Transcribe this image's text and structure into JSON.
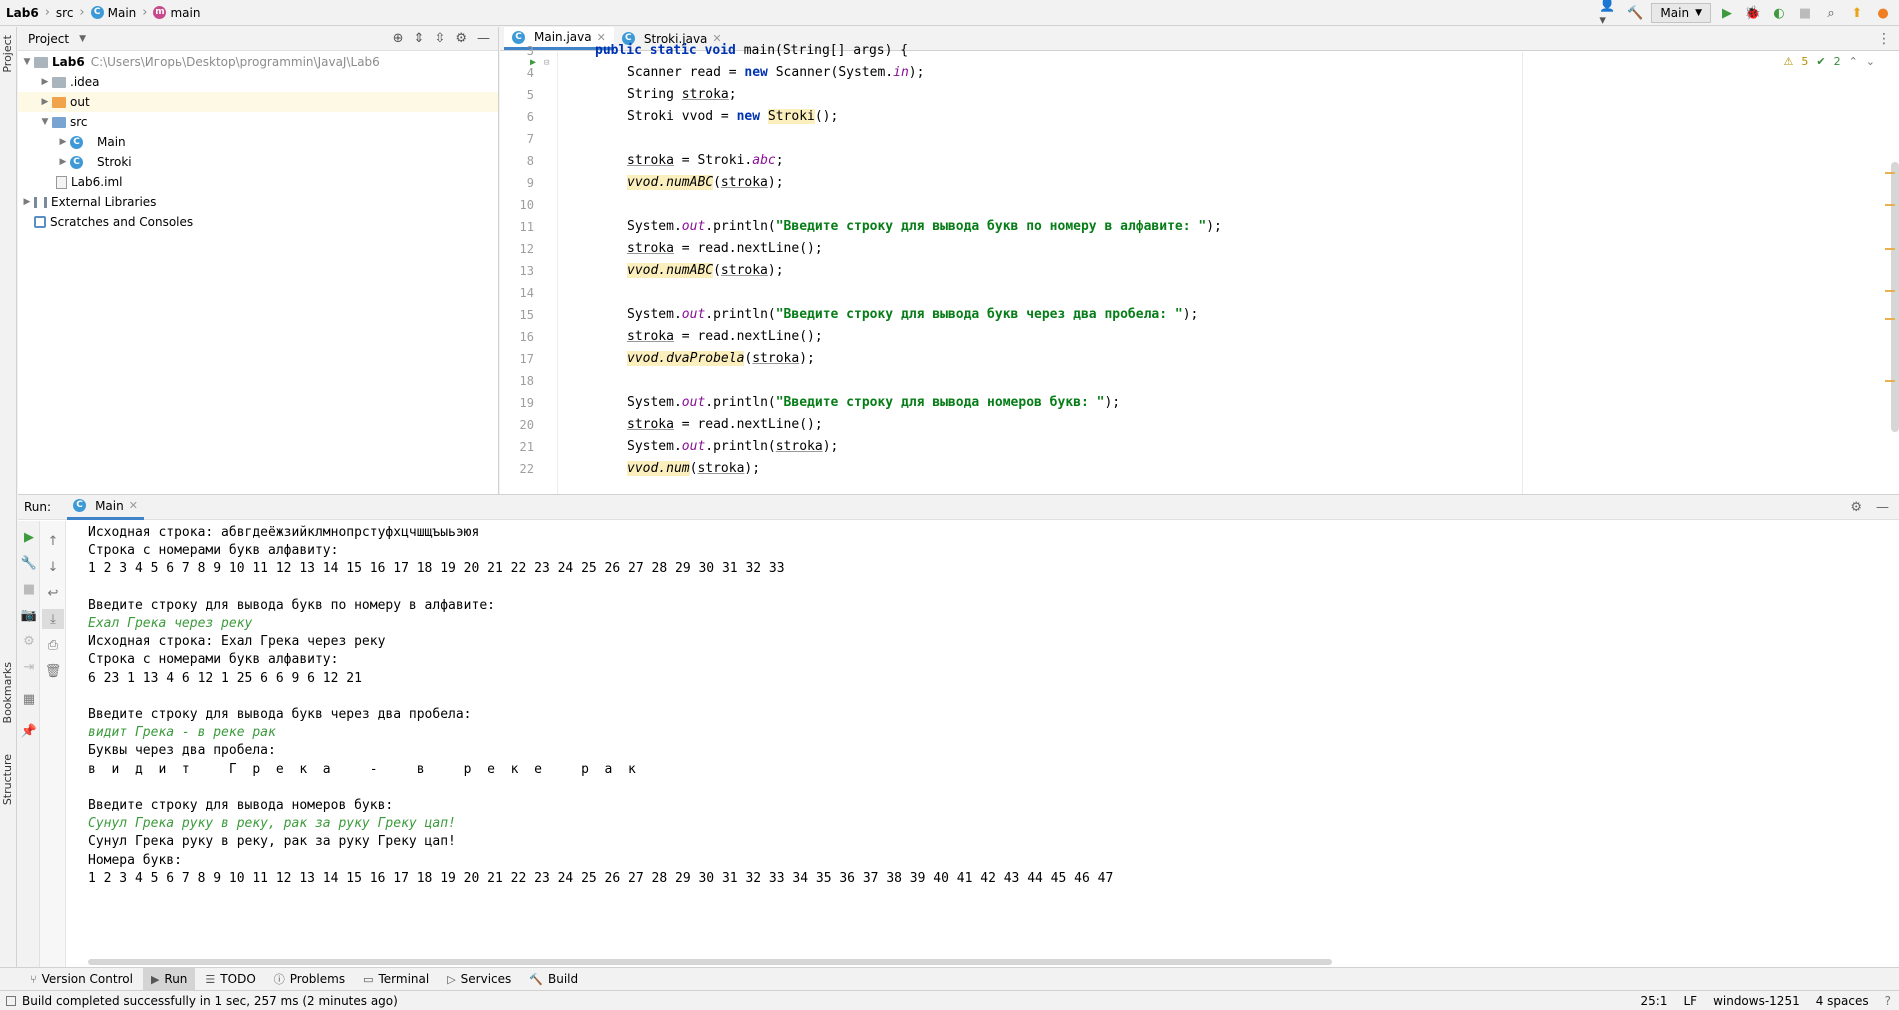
{
  "breadcrumb": {
    "project": "Lab6",
    "folder": "src",
    "class_name": "Main",
    "method": "main"
  },
  "toolbar_top": {
    "run_config": "Main"
  },
  "side_tabs": {
    "project": "Project",
    "bookmarks": "Bookmarks",
    "structure": "Structure"
  },
  "project_panel": {
    "title": "Project",
    "root_name": "Lab6",
    "root_path": "C:\\Users\\Игорь\\Desktop\\programmin\\JavaJ\\Lab6",
    "items": [
      {
        "label": ".idea"
      },
      {
        "label": "out"
      },
      {
        "label": "src"
      },
      {
        "label": "Main"
      },
      {
        "label": "Stroki"
      },
      {
        "label": "Lab6.iml"
      },
      {
        "label": "External Libraries"
      },
      {
        "label": "Scratches and Consoles"
      }
    ]
  },
  "editor": {
    "tabs": [
      {
        "label": "Main.java"
      },
      {
        "label": "Stroki.java"
      }
    ],
    "warnings": "5",
    "checks": "2",
    "line_numbers": [
      "3",
      "4",
      "5",
      "6",
      "7",
      "8",
      "9",
      "10",
      "11",
      "12",
      "13",
      "14",
      "15",
      "16",
      "17",
      "18",
      "19",
      "20",
      "21",
      "22"
    ],
    "code": {
      "l3_a": "public static void ",
      "l3_b": "main(String[] args) {",
      "l4_a": "Scanner read = ",
      "l4_kw": "new",
      "l4_b": " Scanner(System.",
      "l4_fld": "in",
      "l4_c": ");",
      "l5_a": "String ",
      "l5_b": "stroka",
      "l5_c": ";",
      "l6_a": "Stroki vvod = ",
      "l6_kw": "new",
      "l6_b": " ",
      "l6_hl": "Stroki",
      "l6_c": "();",
      "l8_a": "stroka",
      "l8_b": " = Stroki.",
      "l8_fld": "abc",
      "l8_c": ";",
      "l9_hl": "vvod.numABC",
      "l9_a": "(",
      "l9_b": "stroka",
      "l9_c": ");",
      "l11_a": "System.",
      "l11_fld": "out",
      "l11_b": ".println(",
      "l11_str": "\"Введите строку для вывода букв по номеру в алфавите: \"",
      "l11_c": ");",
      "l12_a": "stroka",
      "l12_b": " = read.nextLine();",
      "l13_hl": "vvod.numABC",
      "l13_a": "(",
      "l13_b": "stroka",
      "l13_c": ");",
      "l15_a": "System.",
      "l15_fld": "out",
      "l15_b": ".println(",
      "l15_str": "\"Введите строку для вывода букв через два пробела: \"",
      "l15_c": ");",
      "l16_a": "stroka",
      "l16_b": " = read.nextLine();",
      "l17_hl": "vvod.dvaProbela",
      "l17_a": "(",
      "l17_b": "stroka",
      "l17_c": ");",
      "l19_a": "System.",
      "l19_fld": "out",
      "l19_b": ".println(",
      "l19_str": "\"Введите строку для вывода номеров букв: \"",
      "l19_c": ");",
      "l20_a": "stroka",
      "l20_b": " = read.nextLine();",
      "l21_a": "System.",
      "l21_fld": "out",
      "l21_b": ".println(",
      "l21_u": "stroka",
      "l21_c": ");",
      "l22_hl": "vvod.num",
      "l22_a": "(",
      "l22_b": "stroka",
      "l22_c": ");"
    }
  },
  "run_panel": {
    "label": "Run:",
    "tab": "Main",
    "console": [
      {
        "text": "Исходная строка: абвгдеёжзийклмнопрстуфхцчшщъыьэюя",
        "input": false
      },
      {
        "text": "Строка с номерами букв алфавиту:",
        "input": false
      },
      {
        "text": "1 2 3 4 5 6 7 8 9 10 11 12 13 14 15 16 17 18 19 20 21 22 23 24 25 26 27 28 29 30 31 32 33",
        "input": false
      },
      {
        "text": "",
        "input": false
      },
      {
        "text": "Введите строку для вывода букв по номеру в алфавите:",
        "input": false
      },
      {
        "text": "Ехал Грека через реку",
        "input": true
      },
      {
        "text": "Исходная строка: Ехал Грека через реку",
        "input": false
      },
      {
        "text": "Строка с номерами букв алфавиту:",
        "input": false
      },
      {
        "text": "6 23 1 13 4 6 12 1 25 6 6 9 6 12 21",
        "input": false
      },
      {
        "text": "",
        "input": false
      },
      {
        "text": "Введите строку для вывода букв через два пробела:",
        "input": false
      },
      {
        "text": "видит Грека - в реке рак",
        "input": true
      },
      {
        "text": "Буквы через два пробела:",
        "input": false
      },
      {
        "text": "в  и  д  и  т     Г  р  е  к  а     -     в     р  е  к  е     р  а  к",
        "input": false
      },
      {
        "text": "",
        "input": false
      },
      {
        "text": "Введите строку для вывода номеров букв:",
        "input": false
      },
      {
        "text": "Сунул Грека руку в реку, рак за руку Греку цап!",
        "input": true
      },
      {
        "text": "Сунул Грека руку в реку, рак за руку Греку цап!",
        "input": false
      },
      {
        "text": "Номера букв:",
        "input": false
      },
      {
        "text": "1 2 3 4 5 6 7 8 9 10 11 12 13 14 15 16 17 18 19 20 21 22 23 24 25 26 27 28 29 30 31 32 33 34 35 36 37 38 39 40 41 42 43 44 45 46 47",
        "input": false
      }
    ]
  },
  "tool_windows": [
    {
      "label": "Version Control"
    },
    {
      "label": "Run"
    },
    {
      "label": "TODO"
    },
    {
      "label": "Problems"
    },
    {
      "label": "Terminal"
    },
    {
      "label": "Services"
    },
    {
      "label": "Build"
    }
  ],
  "status": {
    "message": "Build completed successfully in 1 sec, 257 ms (2 minutes ago)",
    "position": "25:1",
    "line_sep": "LF",
    "encoding": "windows-1251",
    "indent": "4 spaces"
  },
  "colors": {
    "accent": "#4083c9",
    "keyword": "#0033b3",
    "string": "#067d17",
    "field": "#871094",
    "highlight": "#fbefbd",
    "console_input": "#3b9b3b"
  }
}
